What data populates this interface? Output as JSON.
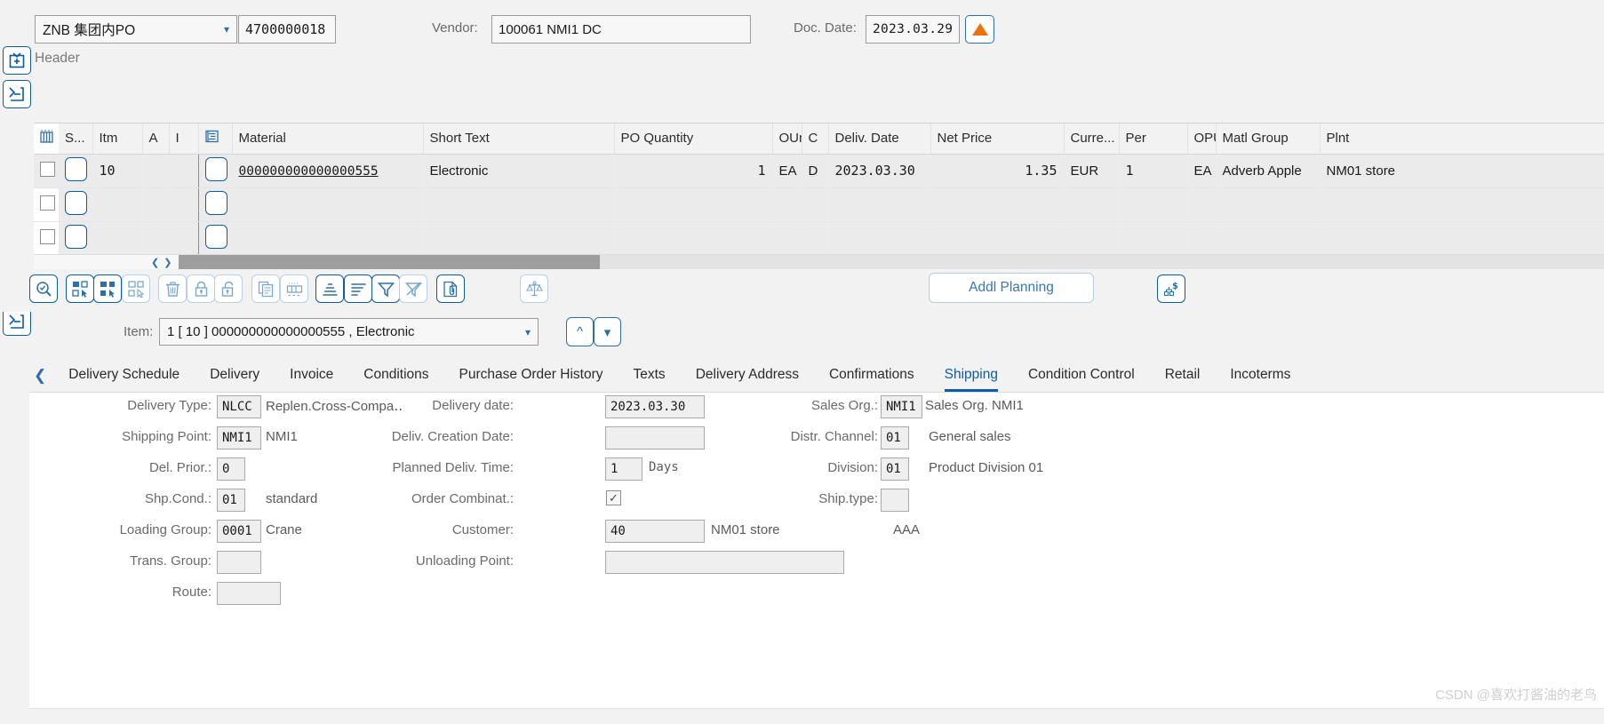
{
  "header": {
    "cart_icon": "shopping-cart-icon",
    "doc_type": "ZNB 集团内PO",
    "po_number": "4700000018",
    "vendor_label": "Vendor:",
    "vendor_value": "100061 NMI1 DC",
    "doc_date_label": "Doc. Date:",
    "doc_date_value": "2023.03.29",
    "expand_icon": "triangle-up-icon",
    "header_section_label": "Header"
  },
  "rail": {
    "buttons": [
      {
        "name": "expand-header-icon",
        "glyph": "⊕"
      },
      {
        "name": "expand-item-icon",
        "glyph": "⌫"
      }
    ]
  },
  "table": {
    "columns": [
      "",
      "S...",
      "Itm",
      "A",
      "I",
      "",
      "Material",
      "Short Text",
      "PO Quantity",
      "OUn",
      "C",
      "Deliv. Date",
      "Net Price",
      "Curre...",
      "Per",
      "OPU",
      "Matl Group",
      "Plnt"
    ],
    "rows": [
      {
        "itm": "10",
        "a": "",
        "i": "",
        "material": "000000000000000555",
        "short_text": "Electronic",
        "po_quantity": "",
        "oun_qty": "1",
        "oun": "EA",
        "c": "D",
        "deliv_date": "2023.03.30",
        "net_price": "1.35",
        "currency": "EUR",
        "per": "1",
        "opu": "EA",
        "matl_group": "Adverb Apple",
        "plnt": "NM01 store"
      },
      {
        "itm": "",
        "a": "",
        "i": "",
        "material": "",
        "short_text": "",
        "po_quantity": "",
        "oun_qty": "",
        "oun": "",
        "c": "",
        "deliv_date": "",
        "net_price": "",
        "currency": "",
        "per": "",
        "opu": "",
        "matl_group": "",
        "plnt": ""
      },
      {
        "itm": "",
        "a": "",
        "i": "",
        "material": "",
        "short_text": "",
        "po_quantity": "",
        "oun_qty": "",
        "oun": "",
        "c": "",
        "deliv_date": "",
        "net_price": "",
        "currency": "",
        "per": "",
        "opu": "",
        "matl_group": "",
        "plnt": ""
      }
    ]
  },
  "toolbar": {
    "icons": [
      {
        "name": "search-details-icon",
        "title": "Display Details"
      },
      {
        "name": "select-all-icon",
        "title": "Select All"
      },
      {
        "name": "select-block-icon",
        "title": "Select Block"
      },
      {
        "name": "deselect-all-icon",
        "title": "Deselect All"
      },
      {
        "name": "delete-icon",
        "title": "Delete"
      },
      {
        "name": "lock-icon",
        "title": "Lock"
      },
      {
        "name": "unlock-icon",
        "title": "Unlock"
      },
      {
        "name": "copy-icon",
        "title": "Copy"
      },
      {
        "name": "insert-row-icon",
        "title": "Insert Row"
      },
      {
        "name": "sort-ascending-icon",
        "title": "Sort Ascending"
      },
      {
        "name": "sort-descending-icon",
        "title": "Sort Descending"
      },
      {
        "name": "filter-icon",
        "title": "Set Filter"
      },
      {
        "name": "filter-delete-icon",
        "title": "Delete Filter"
      },
      {
        "name": "attachment-icon",
        "title": "Attach Document"
      },
      {
        "name": "balance-scale-icon",
        "title": "Check"
      }
    ],
    "addl_planning_label": "Addl Planning",
    "price_network_icon": "price-network-icon"
  },
  "item_selector": {
    "label": "Item:",
    "value": "1 [ 10 ] 000000000000000555 , Electronic",
    "prev_icon": "chevron-up-icon",
    "next_icon": "chevron-down-icon"
  },
  "tabs": {
    "prev_icon": "chevron-left-icon",
    "items": [
      "Delivery Schedule",
      "Delivery",
      "Invoice",
      "Conditions",
      "Purchase Order History",
      "Texts",
      "Delivery Address",
      "Confirmations",
      "Shipping",
      "Condition Control",
      "Retail",
      "Incoterms"
    ],
    "active": "Shipping"
  },
  "shipping_form": {
    "left": [
      {
        "label": "Delivery Type:",
        "value": "NLCC",
        "desc": "Replen.Cross-Compa‥"
      },
      {
        "label": "Shipping Point:",
        "value": "NMI1",
        "desc": "NMI1"
      },
      {
        "label": "Del. Prior.:",
        "value": "0",
        "desc": ""
      },
      {
        "label": "Shp.Cond.:",
        "value": "01",
        "desc": "standard"
      },
      {
        "label": "Loading Group:",
        "value": "0001",
        "desc": "Crane"
      },
      {
        "label": "Trans. Group:",
        "value": "",
        "desc": ""
      },
      {
        "label": "Route:",
        "value": "",
        "desc": ""
      }
    ],
    "middle": [
      {
        "label": "Delivery date:",
        "value": "2023.03.30",
        "desc": ""
      },
      {
        "label": "Deliv. Creation Date:",
        "value": "",
        "desc": ""
      },
      {
        "label": "Planned Deliv. Time:",
        "value": "1",
        "desc": "Days"
      },
      {
        "label": "Order Combinat.:",
        "checked": true,
        "desc": ""
      },
      {
        "label": "Customer:",
        "value": "40",
        "desc": "NM01 store"
      },
      {
        "label": "Unloading Point:",
        "value": "",
        "desc": ""
      }
    ],
    "right": [
      {
        "label": "Sales Org.:",
        "value": "NMI1",
        "desc": "Sales Org. NMI1"
      },
      {
        "label": "Distr. Channel:",
        "value": "01",
        "desc": "General sales"
      },
      {
        "label": "Division:",
        "value": "01",
        "desc": "Product Division 01"
      },
      {
        "label": "Ship.type:",
        "value": "",
        "desc": ""
      },
      {
        "label": "",
        "value": null,
        "desc": "AAA"
      }
    ]
  },
  "watermark": "CSDN @喜欢打酱油的老鸟",
  "colors": {
    "accent": "#0a5ca8",
    "link": "#2b6fad",
    "orange": "#e9730c",
    "label": "#6a6a6a",
    "panel_bg": "#ffffff",
    "page_bg": "#f2f2f2",
    "row_bg": "#ebebeb"
  }
}
